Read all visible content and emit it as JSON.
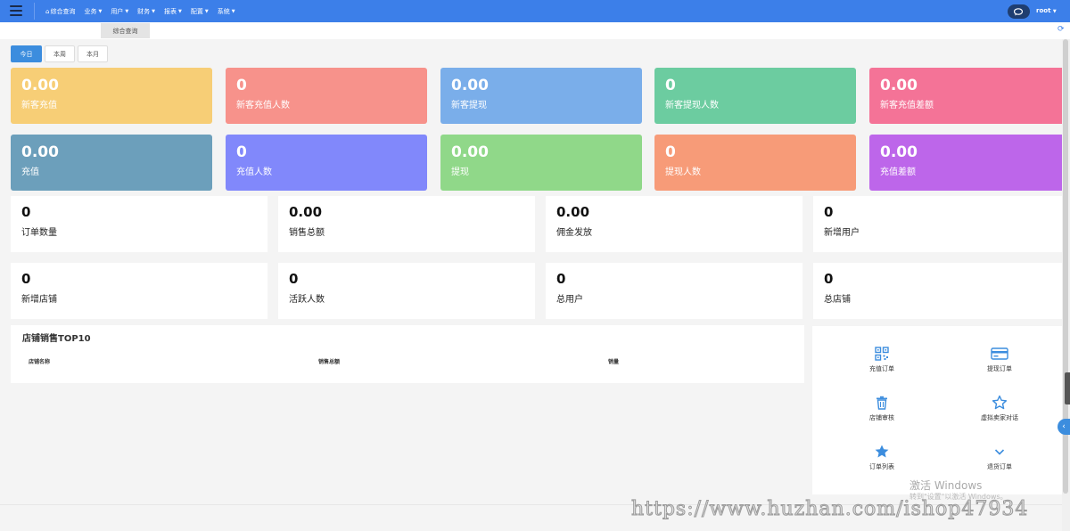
{
  "topbar": {
    "menu": [
      "综合查询",
      "业务",
      "用户",
      "财务",
      "报表",
      "配置",
      "系统"
    ],
    "user": "root"
  },
  "tabs": {
    "active": "综合查询"
  },
  "periods": [
    "今日",
    "本周",
    "本月"
  ],
  "cards_row1": [
    {
      "value": "0.00",
      "label": "新客充值",
      "color": "#f7ce76"
    },
    {
      "value": "0",
      "label": "新客充值人数",
      "color": "#f7928b"
    },
    {
      "value": "0.00",
      "label": "新客提现",
      "color": "#7aaeea"
    },
    {
      "value": "0",
      "label": "新客提现人数",
      "color": "#6ccca0"
    },
    {
      "value": "0.00",
      "label": "新客充值差额",
      "color": "#f47397"
    }
  ],
  "cards_row2": [
    {
      "value": "0.00",
      "label": "充值",
      "color": "#6c9fbb"
    },
    {
      "value": "0",
      "label": "充值人数",
      "color": "#8188fb"
    },
    {
      "value": "0.00",
      "label": "提现",
      "color": "#90d889"
    },
    {
      "value": "0",
      "label": "提现人数",
      "color": "#f79b78"
    },
    {
      "value": "0.00",
      "label": "充值差额",
      "color": "#bd66ea"
    }
  ],
  "stats_row1": [
    {
      "value": "0",
      "label": "订单数量"
    },
    {
      "value": "0.00",
      "label": "销售总额"
    },
    {
      "value": "0.00",
      "label": "佣金发放"
    },
    {
      "value": "0",
      "label": "新增用户"
    }
  ],
  "stats_row2": [
    {
      "value": "0",
      "label": "新增店铺"
    },
    {
      "value": "0",
      "label": "活跃人数"
    },
    {
      "value": "0",
      "label": "总用户"
    },
    {
      "value": "0",
      "label": "总店铺"
    }
  ],
  "top10": {
    "title": "店铺销售TOP10",
    "columns": [
      "店铺名称",
      "销售总额",
      "销量"
    ]
  },
  "quick_links": [
    {
      "label": "充值订单",
      "icon": "qrcode-icon"
    },
    {
      "label": "提现订单",
      "icon": "credit-card-icon"
    },
    {
      "label": "店铺审核",
      "icon": "trash-icon"
    },
    {
      "label": "虚拟卖家对话",
      "icon": "star-outline-icon"
    },
    {
      "label": "订单列表",
      "icon": "star-icon"
    },
    {
      "label": "退货订单",
      "icon": "chevron-down-icon"
    }
  ],
  "overlay": {
    "url": "https://www.huzhan.com/ishop47934",
    "win_title": "激活 Windows",
    "win_sub": "转到\"设置\"以激活 Windows。"
  }
}
